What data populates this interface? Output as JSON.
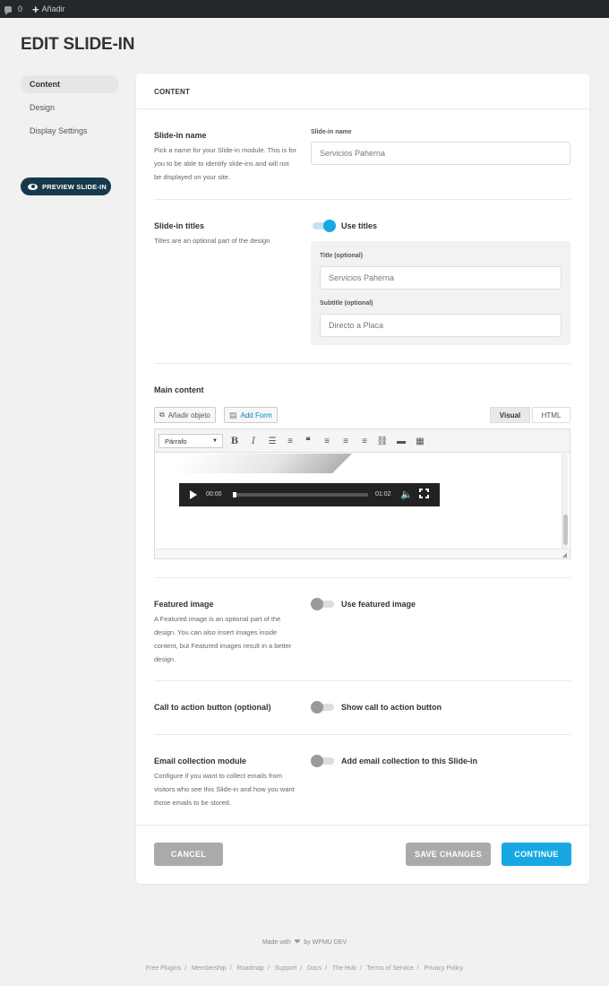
{
  "admin_bar": {
    "comments_count": "0",
    "add_label": "Añadir"
  },
  "page_title": "EDIT SLIDE-IN",
  "sidebar": {
    "items": [
      {
        "label": "Content",
        "active": true
      },
      {
        "label": "Design",
        "active": false
      },
      {
        "label": "Display Settings",
        "active": false
      }
    ],
    "preview_label": "PREVIEW SLIDE-IN"
  },
  "panel": {
    "header": "CONTENT",
    "name_section": {
      "title": "Slide-in name",
      "description": "Pick a name for your Slide-in module. This is for you to be able to identify slide-ins and will not be displayed on your site.",
      "field_label": "Slide-in name",
      "field_value": "Servicios Paherna"
    },
    "titles_section": {
      "title": "Slide-in titles",
      "description": "Titles are an optional part of the design",
      "toggle_label": "Use titles",
      "toggle_on": true,
      "title_label": "Title (optional)",
      "title_value": "Servicios Paherna",
      "subtitle_label": "Subtitle (optional)",
      "subtitle_value": "Directo a Placa"
    },
    "main_content": {
      "title": "Main content",
      "add_object_label": "Añadir objeto",
      "add_form_label": "Add Form",
      "tab_visual": "Visual",
      "tab_html": "HTML",
      "format_select": "Párrafo",
      "player": {
        "current_time": "00:00",
        "duration": "01:02",
        "progress": 0
      }
    },
    "featured_section": {
      "title": "Featured image",
      "description": "A Featured image is an optional part of the design. You can also insert images inside content, but Featured images result in a better design.",
      "toggle_label": "Use featured image",
      "toggle_on": false
    },
    "cta_section": {
      "title": "Call to action button (optional)",
      "toggle_label": "Show call to action button",
      "toggle_on": false
    },
    "email_section": {
      "title": "Email collection module",
      "description": "Configure if you want to collect emails from visitors who see this Slide-in and how you want those emails to be stored.",
      "toggle_label": "Add email collection to this Slide-in",
      "toggle_on": false
    },
    "buttons": {
      "cancel": "CANCEL",
      "save": "SAVE CHANGES",
      "continue": "CONTINUE"
    }
  },
  "footer": {
    "made_with_prefix": "Made with",
    "made_with_suffix": "by WPMU DEV",
    "links": [
      "Free Plugins",
      "Membership",
      "Roadmap",
      "Support",
      "Docs",
      "The Hub",
      "Terms of Service",
      "Privacy Policy"
    ]
  },
  "colors": {
    "accent": "#17a8e3",
    "dark_button": "#17394c",
    "admin_bar": "#23282d"
  }
}
